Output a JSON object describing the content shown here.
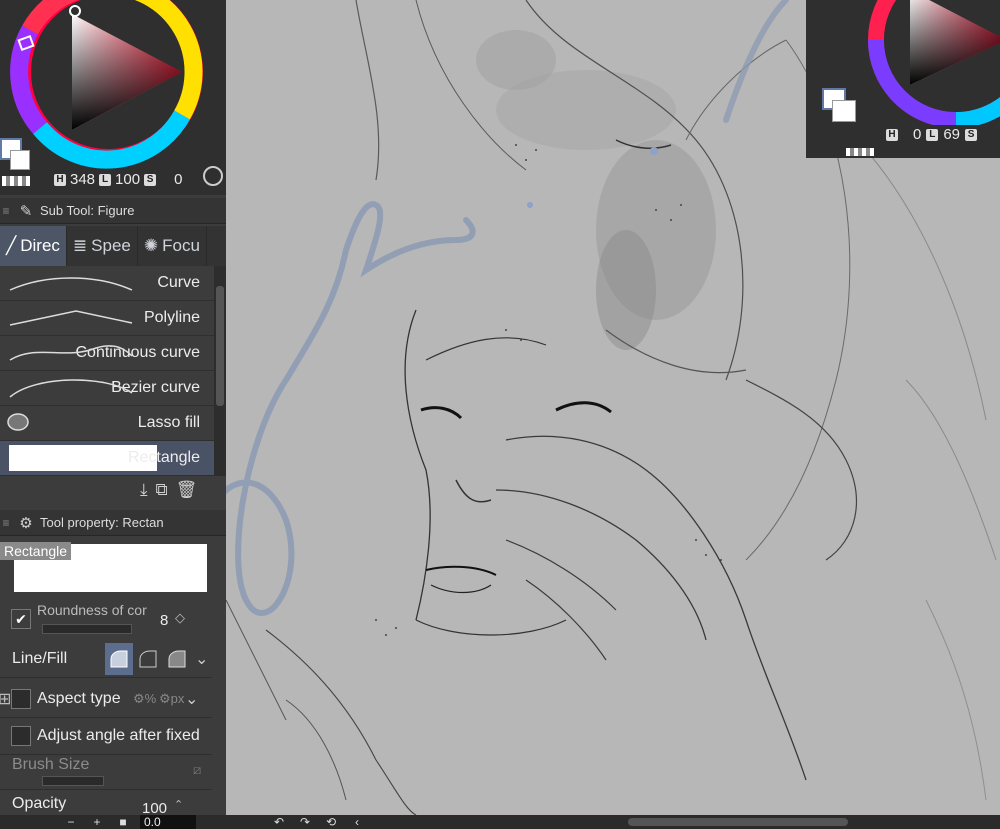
{
  "color": {
    "h": "348",
    "l": "100",
    "s": "0",
    "h_tag": "H",
    "l_tag": "L",
    "s_tag": "S",
    "secondary_h_tag": "H",
    "secondary_h": "0",
    "secondary_l_tag": "L",
    "secondary_l": "69",
    "secondary_s_tag": "S"
  },
  "subtool": {
    "title": "Sub Tool: Figure",
    "tabs": [
      {
        "label": "Direc",
        "icon": "direct-draw-icon"
      },
      {
        "label": "Spee",
        "icon": "speed-lines-icon"
      },
      {
        "label": "Focu",
        "icon": "focus-lines-icon"
      }
    ],
    "items": [
      {
        "label": "Curve"
      },
      {
        "label": "Polyline"
      },
      {
        "label": "Continuous curve"
      },
      {
        "label": "Bezier curve"
      },
      {
        "label": "Lasso fill"
      },
      {
        "label": "Rectangle"
      }
    ]
  },
  "toolprop": {
    "title": "Tool property: Rectan",
    "preset_label": "Rectangle",
    "roundness_label": "Roundness of cor",
    "roundness_value": "8",
    "linefill_label": "Line/Fill",
    "aspect_label": "Aspect type",
    "adjust_label": "Adjust angle after fixed",
    "brush_size_label": "Brush Size",
    "opacity_label": "Opacity",
    "opacity_value": "100"
  },
  "bottom": {
    "minus": "−",
    "plus": "+",
    "zoom_value": "0.0"
  },
  "colors": {
    "canvas": "#b7b7b7",
    "panel": "#3c3c3c",
    "accent": "#5d6d8e",
    "stroke_blue": "#8e9bb3"
  }
}
